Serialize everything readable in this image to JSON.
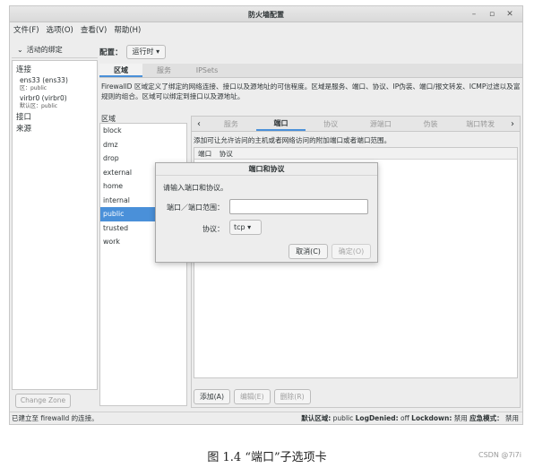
{
  "window": {
    "title": "防火墙配置",
    "minimize": "–",
    "maximize": "▫",
    "close": "✕"
  },
  "menu": [
    "文件(F)",
    "选项(O)",
    "查看(V)",
    "帮助(H)"
  ],
  "sidebar": {
    "binding_label": "活动的绑定",
    "connections_header": "连接",
    "connections": [
      {
        "name": "ens33 (ens33)",
        "zone": "区：public"
      },
      {
        "name": "virbr0 (virbr0)",
        "zone": "默认区：public"
      }
    ],
    "interfaces_header": "接口",
    "sources_header": "来源",
    "change_zone": "Change Zone"
  },
  "config": {
    "label": "配置：",
    "value": "运行时"
  },
  "top_tabs": [
    "区域",
    "服务",
    "IPSets"
  ],
  "zone_description": "FirewallD 区域定义了绑定的网络连接、接口以及源地址的可信程度。区域是服务、端口、协议、IP伪装、端口/报文转发、ICMP过滤以及富规则的组合。区域可以绑定到接口以及源地址。",
  "zones_label": "区域",
  "zones": [
    "block",
    "dmz",
    "drop",
    "external",
    "home",
    "internal",
    "public",
    "trusted",
    "work"
  ],
  "selected_zone": "public",
  "inner_tabs": [
    "服务",
    "端口",
    "协议",
    "源端口",
    "伪装",
    "端口转发"
  ],
  "ports": {
    "description": "添加可让允许访问的主机或者网络访问的附加端口或者端口范围。",
    "columns": [
      "端口",
      "协议"
    ],
    "buttons": {
      "add": "添加(A)",
      "edit": "编辑(E)",
      "remove": "删除(R)"
    }
  },
  "dialog": {
    "title": "端口和协议",
    "prompt": "请输入端口和协议。",
    "port_label": "端口／端口范围：",
    "port_value": "",
    "protocol_label": "协议：",
    "protocol_value": "tcp",
    "cancel": "取消(C)",
    "ok": "确定(O)"
  },
  "status": {
    "left": "已建立至 firewalld 的连接。",
    "default_zone_label": "默认区域:",
    "default_zone": "public",
    "log_denied_label": "LogDenied:",
    "log_denied": "off",
    "lockdown_label": "Lockdown:",
    "lockdown": "禁用",
    "panic_label": "应急模式：",
    "panic": "禁用"
  },
  "caption": "图 1.4 “端口”子选项卡",
  "watermark": "CSDN @7i7i"
}
